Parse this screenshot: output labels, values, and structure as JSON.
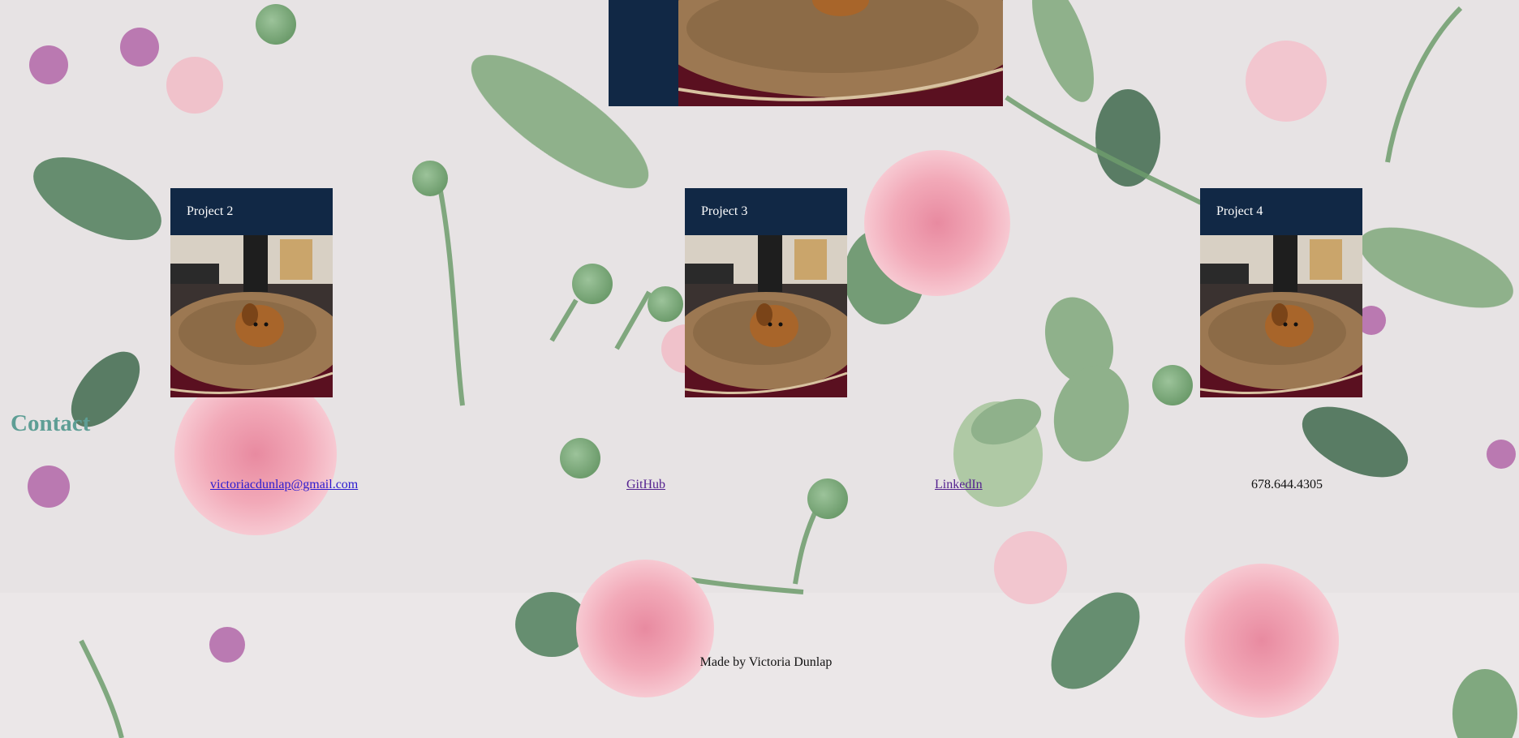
{
  "projects": [
    {
      "title": "Project 2"
    },
    {
      "title": "Project 3"
    },
    {
      "title": "Project 4"
    }
  ],
  "contact": {
    "heading": "Contact",
    "email": "victoriacdunlap@gmail.com",
    "github": "GitHub",
    "linkedin": "LinkedIn",
    "phone": "678.644.4305"
  },
  "footer": {
    "credit": "Made by Victoria Dunlap"
  },
  "colors": {
    "card": "#112845",
    "heading": "#5e9e95",
    "link": "#2a1ad0",
    "visited_link": "#54228f"
  }
}
